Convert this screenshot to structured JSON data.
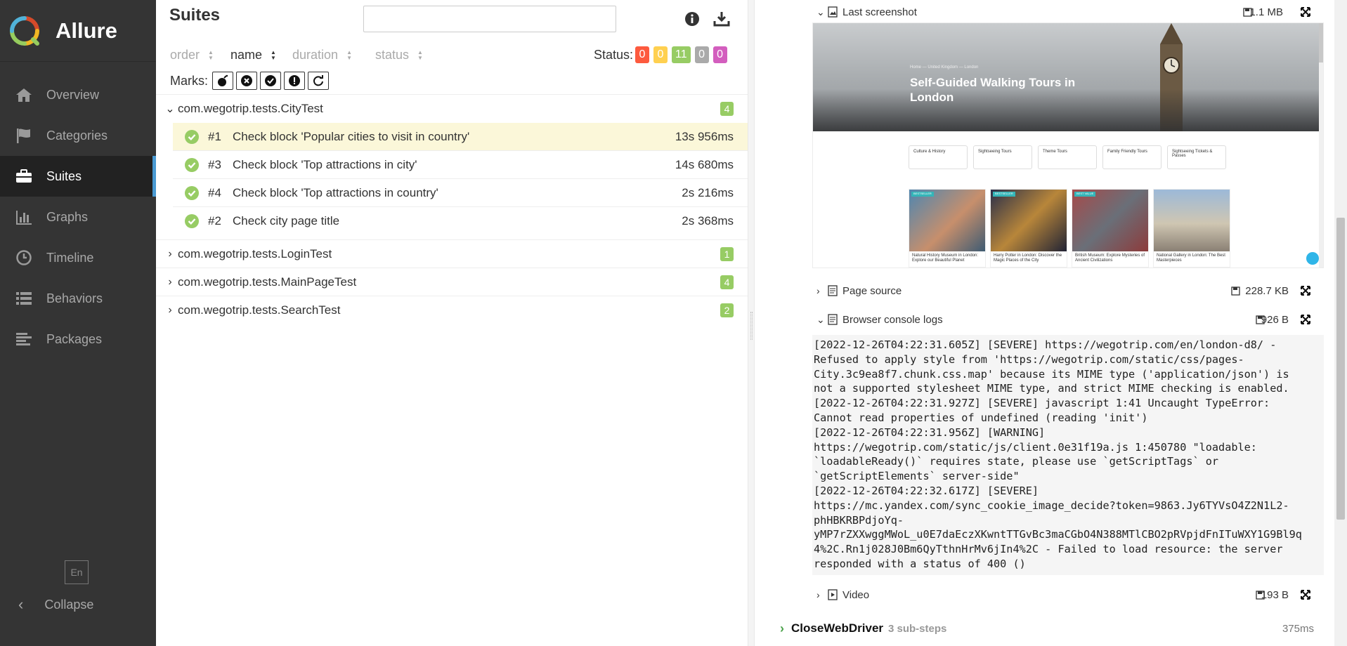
{
  "brand": {
    "name": "Allure"
  },
  "nav": [
    {
      "label": "Overview",
      "icon": "home-icon"
    },
    {
      "label": "Categories",
      "icon": "flag-icon"
    },
    {
      "label": "Suites",
      "icon": "briefcase-icon"
    },
    {
      "label": "Graphs",
      "icon": "bar-chart-icon"
    },
    {
      "label": "Timeline",
      "icon": "clock-icon"
    },
    {
      "label": "Behaviors",
      "icon": "list-icon"
    },
    {
      "label": "Packages",
      "icon": "packages-icon"
    }
  ],
  "active_nav": "Suites",
  "language": "En",
  "collapse_label": "Collapse",
  "suites": {
    "title": "Suites",
    "search_value": "",
    "sort": {
      "order": "order",
      "name": "name",
      "duration": "duration",
      "status": "status"
    },
    "status_label": "Status:",
    "status_counts": [
      {
        "value": "0",
        "color": "#fd5a3e"
      },
      {
        "value": "0",
        "color": "#ffd050"
      },
      {
        "value": "11",
        "color": "#97cc64"
      },
      {
        "value": "0",
        "color": "#aaaaaa"
      },
      {
        "value": "0",
        "color": "#d35ebe"
      }
    ],
    "marks_label": "Marks:",
    "marks": [
      "flaky-icon",
      "new-failed-icon",
      "new-passed-icon",
      "new-broken-icon",
      "retries-icon"
    ],
    "groups": [
      {
        "name": "com.wegotrip.tests.CityTest",
        "count": "4",
        "expanded": true,
        "tests": [
          {
            "num": "#1",
            "name": "Check block 'Popular cities to visit in country'",
            "duration": "13s 956ms",
            "selected": true
          },
          {
            "num": "#3",
            "name": "Check block 'Top attractions in city'",
            "duration": "14s 680ms",
            "selected": false
          },
          {
            "num": "#4",
            "name": "Check block 'Top attractions in country'",
            "duration": "2s 216ms",
            "selected": false
          },
          {
            "num": "#2",
            "name": "Check city page title",
            "duration": "2s 368ms",
            "selected": false
          }
        ]
      },
      {
        "name": "com.wegotrip.tests.LoginTest",
        "count": "1",
        "expanded": false
      },
      {
        "name": "com.wegotrip.tests.MainPageTest",
        "count": "4",
        "expanded": false
      },
      {
        "name": "com.wegotrip.tests.SearchTest",
        "count": "2",
        "expanded": false
      }
    ]
  },
  "attachments": {
    "screenshot": {
      "name": "Last screenshot",
      "size": "1.1 MB"
    },
    "page_source": {
      "name": "Page source",
      "size": "228.7 KB"
    },
    "console_logs": {
      "name": "Browser console logs",
      "size": "926 B"
    },
    "video": {
      "name": "Video",
      "size": "193 B"
    }
  },
  "screenshot_content": {
    "breadcrumb": "Home  —  United Kingdom  —  London",
    "title": "Self-Guided Walking Tours in London",
    "categories": [
      "Culture & History",
      "Sightseeing Tours",
      "Theme Tours",
      "Family Friendly Tours",
      "Sightseeing Tickets & Passes"
    ],
    "cards": [
      {
        "tag": "BESTSELLER",
        "text": "Natural History Museum in London: Explore our Beautiful Planet"
      },
      {
        "tag": "BESTSELLER",
        "text": "Harry Potter in London: Discover the Magic Places of the City"
      },
      {
        "tag": "BEST VALUE",
        "text": "British Museum: Explore Mysteries of Ancient Civilizations"
      },
      {
        "tag": "",
        "text": "National Gallery in London: The Best Masterpieces"
      }
    ]
  },
  "console_log_text": "[2022-12-26T04:22:31.605Z] [SEVERE] https://wegotrip.com/en/london-d8/ -\nRefused to apply style from 'https://wegotrip.com/static/css/pages-\nCity.3c9ea8f7.chunk.css.map' because its MIME type ('application/json') is\nnot a supported stylesheet MIME type, and strict MIME checking is enabled.\n[2022-12-26T04:22:31.927Z] [SEVERE] javascript 1:41 Uncaught TypeError:\nCannot read properties of undefined (reading 'init')\n[2022-12-26T04:22:31.956Z] [WARNING]\nhttps://wegotrip.com/static/js/client.0e31f19a.js 1:450780 \"loadable:\n`loadableReady()` requires state, please use `getScriptTags` or\n`getScriptElements` server-side\"\n[2022-12-26T04:22:32.617Z] [SEVERE]\nhttps://mc.yandex.com/sync_cookie_image_decide?token=9863.Jy6TYVsO4Z2N1L2-\nphHBKRBPdjoYq-\nyMP7rZXXwggMWoL_u0E7daEczXKwntTTGvBc3maCGbO4N388MTlCBO2pRVpjdFnITuWXY1G9Bl9q\n4%2C.Rn1j028J0Bm6QyTthnHrMv6jIn4%2C - Failed to load resource: the server\nresponded with a status of 400 ()",
  "step": {
    "name": "CloseWebDriver",
    "sub_steps": "3 sub-steps",
    "duration": "375ms"
  }
}
